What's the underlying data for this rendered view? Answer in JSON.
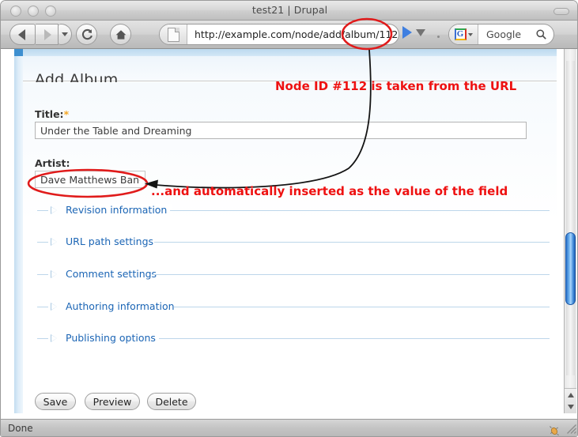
{
  "window": {
    "title": "test21 | Drupal",
    "traffic_lights": [
      "close",
      "minimize",
      "zoom"
    ]
  },
  "toolbar": {
    "back_label": "Back",
    "forward_label": "Forward",
    "history_dropdown_label": "History",
    "reload_label": "Reload",
    "home_label": "Home",
    "url": "http://example.com/node/add/album/112",
    "go_label": "Go",
    "go_dropdown_label": "Go options",
    "search_engine": "Google",
    "search_engine_badge": "G",
    "search_placeholder": "Google",
    "search_value": ""
  },
  "page": {
    "title": "Add Album",
    "fields": [
      {
        "label": "Title:",
        "required": true,
        "required_marker": "*",
        "value": "Under the Table and Dreaming"
      },
      {
        "label": "Artist:",
        "required": false,
        "required_marker": "",
        "value": "Dave Matthews Band"
      }
    ],
    "fieldsets": [
      {
        "legend": "Revision information",
        "collapsed": true
      },
      {
        "legend": "URL path settings",
        "collapsed": true
      },
      {
        "legend": "Comment settings",
        "collapsed": true
      },
      {
        "legend": "Authoring information",
        "collapsed": true
      },
      {
        "legend": "Publishing options",
        "collapsed": true
      }
    ],
    "buttons": [
      {
        "label": "Save"
      },
      {
        "label": "Preview"
      },
      {
        "label": "Delete"
      }
    ]
  },
  "annotations": {
    "color": "#ee1111",
    "note_url": "Node ID #112 is taken from the URL",
    "note_field": "...and automatically inserted as the value of the field",
    "highlight_url_segment": "112",
    "highlight_field_value": "Dave Matthews Band"
  },
  "statusbar": {
    "text": "Done"
  },
  "scrollbar": {
    "orientation": "vertical",
    "thumb_position_percent": 55,
    "up_arrow": "scroll-up",
    "down_arrow": "scroll-down"
  }
}
